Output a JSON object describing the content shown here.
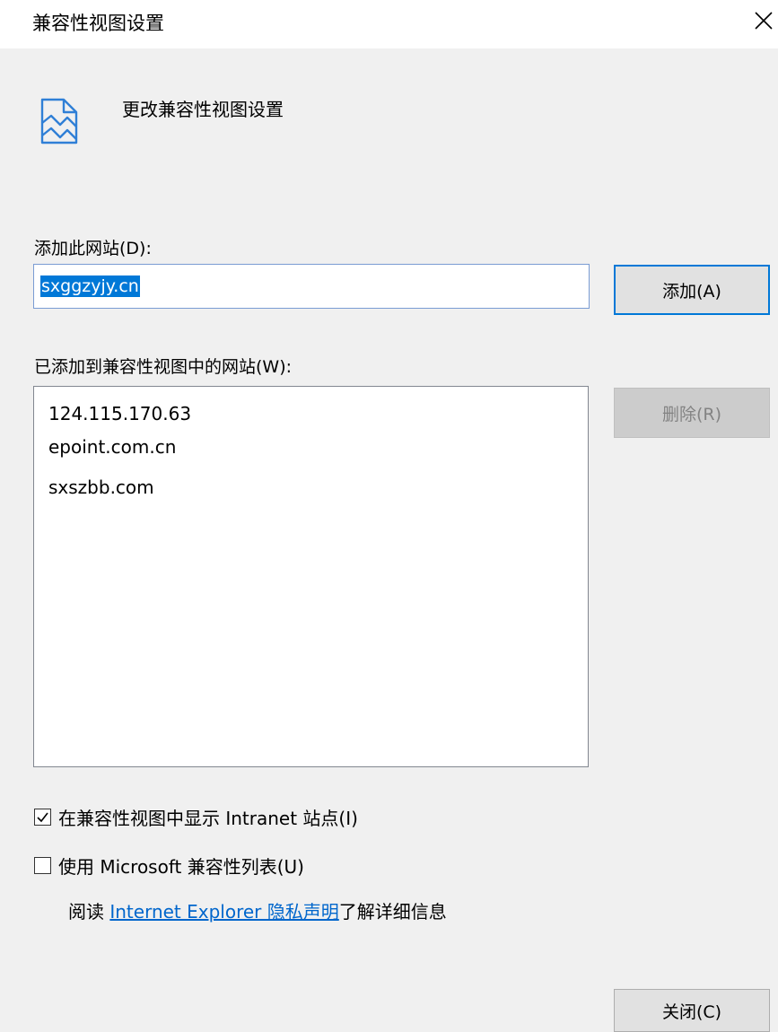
{
  "window": {
    "title": "兼容性视图设置",
    "close_glyph": "✕"
  },
  "header": {
    "icon": "compat-view-icon",
    "text": "更改兼容性视图设置"
  },
  "add_section": {
    "label": "添加此网站(D):",
    "input_value": "sxggzyjy.cn",
    "add_button": "添加(A)"
  },
  "list_section": {
    "label": "已添加到兼容性视图中的网站(W):",
    "sites": [
      "124.115.170.63",
      "epoint.com.cn",
      "sxszbb.com"
    ],
    "remove_button": "删除(R)"
  },
  "options": {
    "intranet": {
      "label": "在兼容性视图中显示 Intranet 站点(I)",
      "checked": true
    },
    "ms_list": {
      "label": "使用 Microsoft 兼容性列表(U)",
      "checked": false
    }
  },
  "privacy": {
    "prefix": "阅读 ",
    "link": "Internet Explorer 隐私声明",
    "suffix": "了解详细信息"
  },
  "footer": {
    "close_button": "关闭(C)"
  },
  "colors": {
    "accent": "#0078d7",
    "link": "#0066cc",
    "background": "#f0f0f0"
  }
}
